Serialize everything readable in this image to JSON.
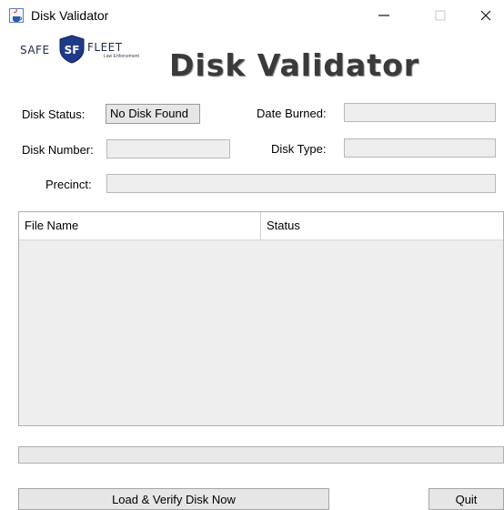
{
  "window": {
    "title": "Disk Validator",
    "minimize_glyph": "—",
    "maximize_glyph": "☐",
    "close_glyph": "✕",
    "app_icon": "java-icon"
  },
  "logo": {
    "left_text": "SAFE",
    "monogram": "SF",
    "right_text": "FLEET",
    "tagline": "Law Enforcement"
  },
  "header": {
    "title": "Disk Validator"
  },
  "form": {
    "disk_status": {
      "label": "Disk Status:",
      "value": "No Disk Found"
    },
    "date_burned": {
      "label": "Date Burned:",
      "value": ""
    },
    "disk_number": {
      "label": "Disk Number:",
      "value": ""
    },
    "disk_type": {
      "label": "Disk Type:",
      "value": ""
    },
    "precinct": {
      "label": "Precinct:",
      "value": ""
    }
  },
  "table": {
    "columns": [
      "File Name",
      "Status"
    ],
    "rows": []
  },
  "progress": {
    "value": 0
  },
  "buttons": {
    "load": "Load & Verify Disk Now",
    "quit": "Quit"
  },
  "colors": {
    "brand_navy": "#1f3a8a",
    "field_bg": "#eeeeee",
    "title_text": "#3a3a3a"
  }
}
